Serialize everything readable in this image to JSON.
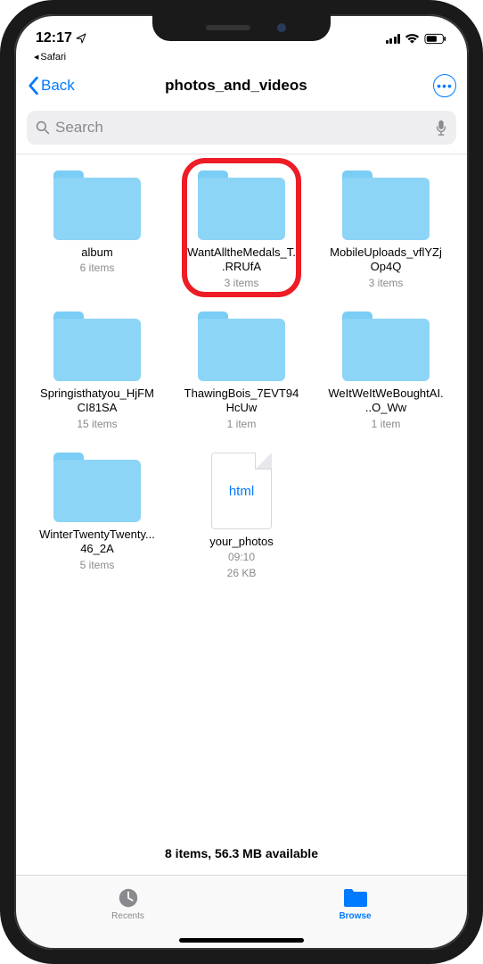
{
  "status": {
    "time": "12:17",
    "app_return": "Safari"
  },
  "nav": {
    "back_label": "Back",
    "title": "photos_and_videos"
  },
  "search": {
    "placeholder": "Search"
  },
  "items": [
    {
      "type": "folder",
      "name": "album",
      "meta": "6 items",
      "highlighted": false
    },
    {
      "type": "folder",
      "name": "IWantAlltheMedals_T...RRUfA",
      "meta": "3 items",
      "highlighted": true
    },
    {
      "type": "folder",
      "name": "MobileUploads_vflYZjOp4Q",
      "meta": "3 items",
      "highlighted": false
    },
    {
      "type": "folder",
      "name": "Springisthatyou_HjFMCI81SA",
      "meta": "15 items",
      "highlighted": false
    },
    {
      "type": "folder",
      "name": "ThawingBois_7EVT94HcUw",
      "meta": "1 item",
      "highlighted": false
    },
    {
      "type": "folder",
      "name": "WeItWeItWeBoughtAI...O_Ww",
      "meta": "1 item",
      "highlighted": false
    },
    {
      "type": "folder",
      "name": "WinterTwentyTwenty...46_2A",
      "meta": "5 items",
      "highlighted": false
    },
    {
      "type": "file",
      "ext": "html",
      "name": "your_photos",
      "meta": "09:10\n26 KB",
      "highlighted": false
    }
  ],
  "footer": {
    "status": "8 items, 56.3 MB available"
  },
  "tabs": {
    "recents": "Recents",
    "browse": "Browse"
  }
}
